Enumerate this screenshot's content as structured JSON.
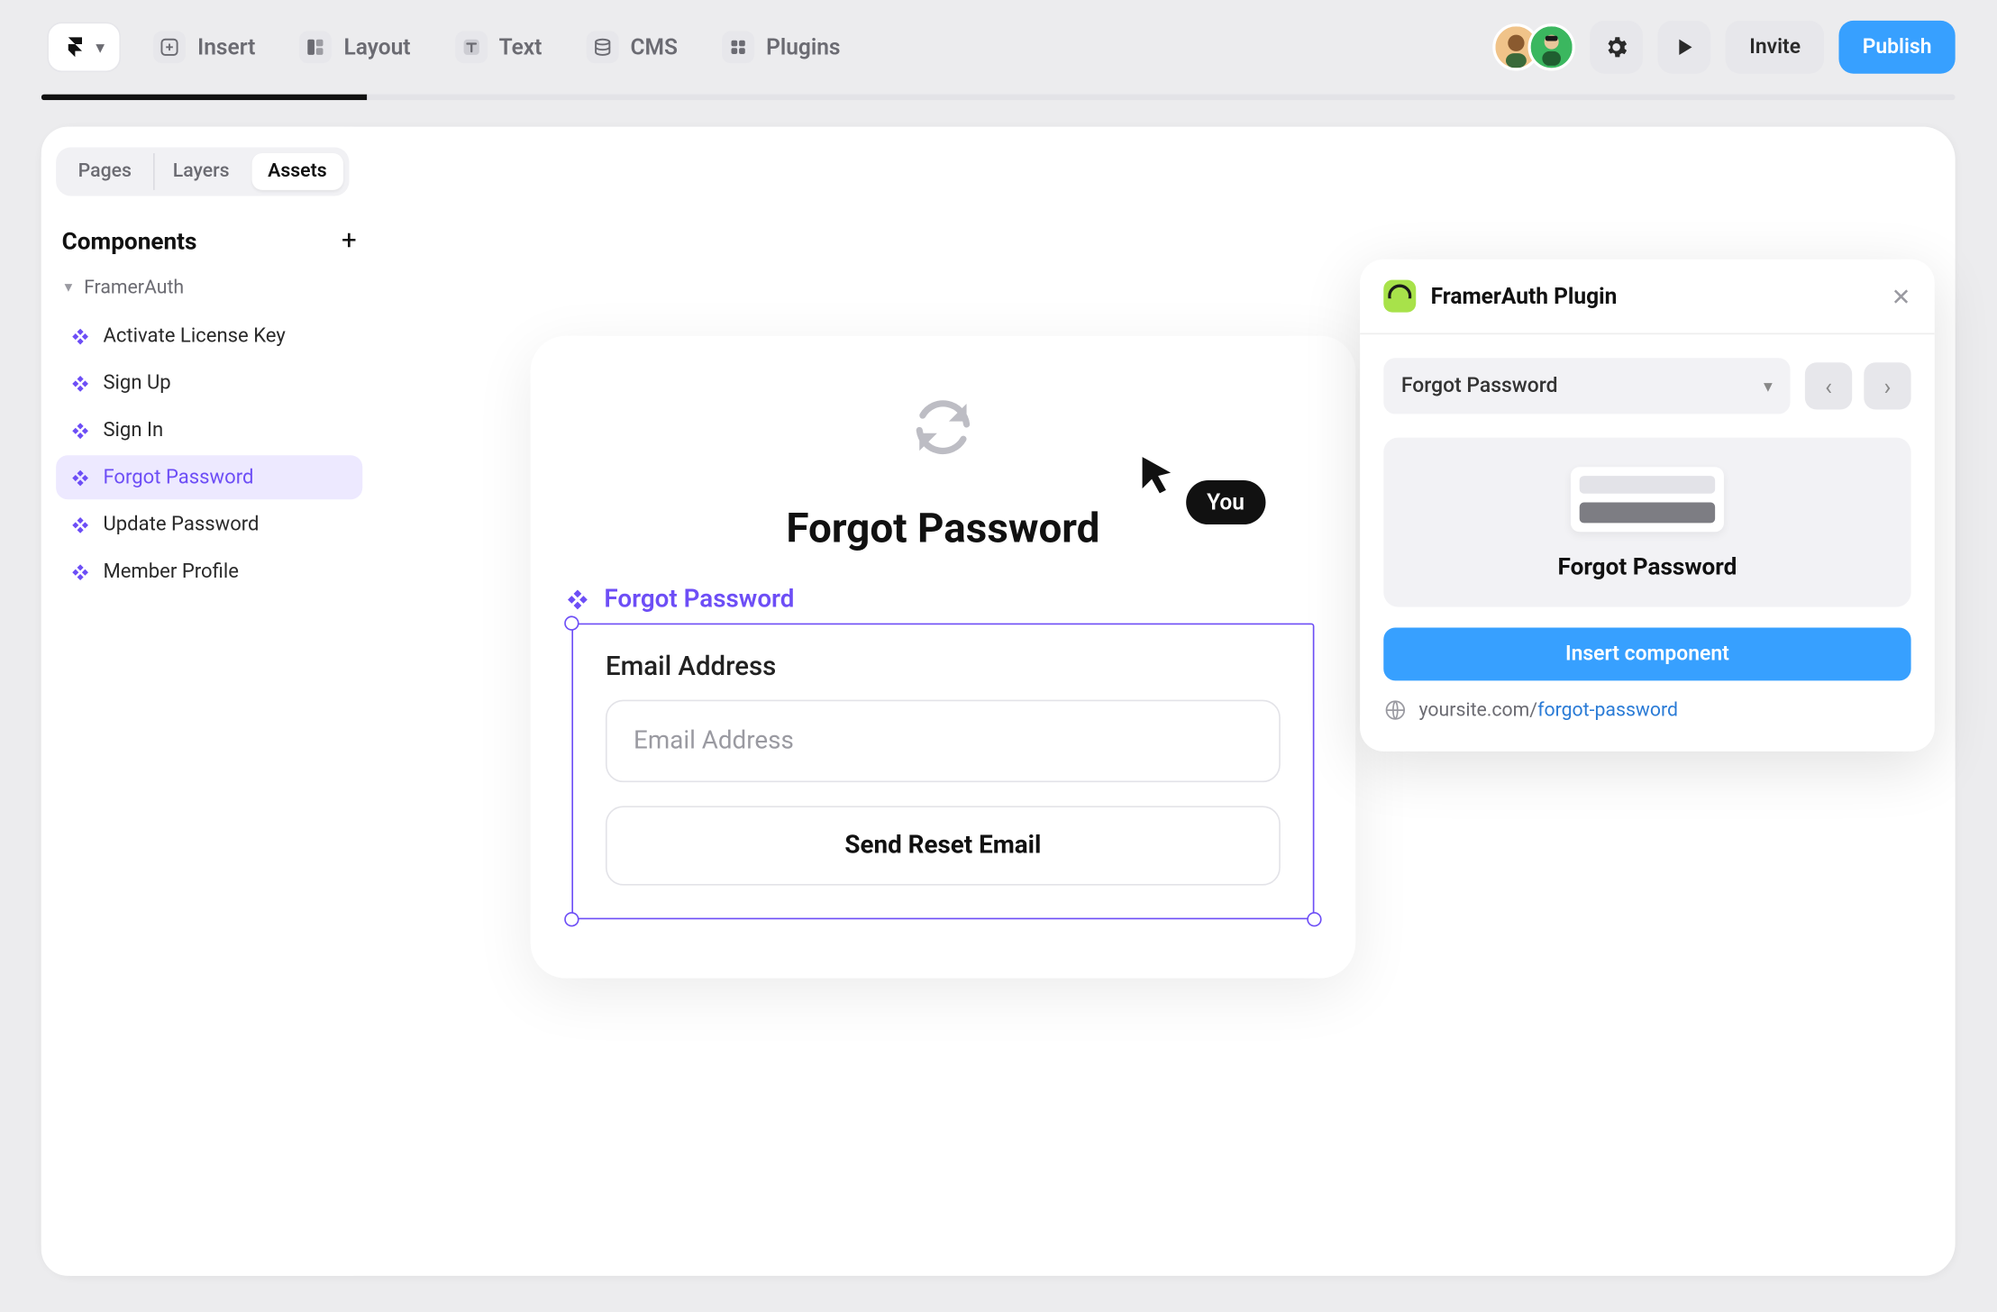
{
  "toolbar": {
    "items": [
      {
        "id": "insert",
        "label": "Insert"
      },
      {
        "id": "layout",
        "label": "Layout"
      },
      {
        "id": "text",
        "label": "Text"
      },
      {
        "id": "cms",
        "label": "CMS"
      },
      {
        "id": "plugins",
        "label": "Plugins"
      }
    ],
    "invite_label": "Invite",
    "publish_label": "Publish"
  },
  "sidebar": {
    "tabs": [
      {
        "id": "pages",
        "label": "Pages",
        "active": false
      },
      {
        "id": "layers",
        "label": "Layers",
        "active": false
      },
      {
        "id": "assets",
        "label": "Assets",
        "active": true
      }
    ],
    "section_title": "Components",
    "category": "FramerAuth",
    "items": [
      {
        "id": "activate",
        "label": "Activate License Key",
        "active": false
      },
      {
        "id": "signup",
        "label": "Sign Up",
        "active": false
      },
      {
        "id": "signin",
        "label": "Sign In",
        "active": false
      },
      {
        "id": "forgot",
        "label": "Forgot Password",
        "active": true
      },
      {
        "id": "update",
        "label": "Update Password",
        "active": false
      },
      {
        "id": "profile",
        "label": "Member Profile",
        "active": false
      }
    ]
  },
  "canvas": {
    "card_title": "Forgot Password",
    "component_label": "Forgot Password",
    "field_label": "Email Address",
    "input_placeholder": "Email Address",
    "button_label": "Send Reset Email"
  },
  "cursor": {
    "user_label": "You"
  },
  "plugin_panel": {
    "title": "FramerAuth Plugin",
    "selected_component": "Forgot Password",
    "preview_label": "Forgot Password",
    "insert_label": "Insert component",
    "url_base": "yoursite.com/",
    "url_slug": "forgot-password"
  },
  "colors": {
    "primary_blue": "#37a0ff",
    "accent_purple": "#6d4ef6",
    "accent_purple_bg": "#ede9ff",
    "brand_green": "#a8e24a"
  }
}
